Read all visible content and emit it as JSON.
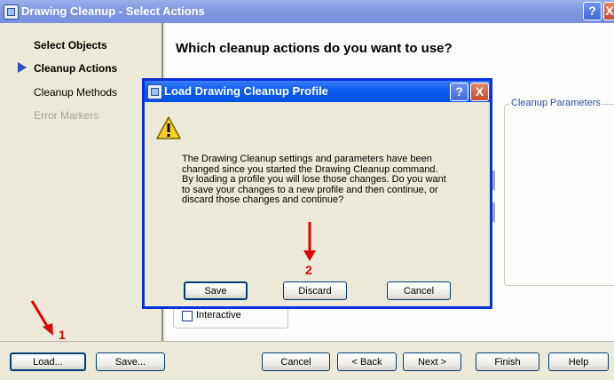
{
  "window": {
    "title": "Drawing Cleanup - Select Actions",
    "help_glyph": "?",
    "close_glyph": "X"
  },
  "nav": {
    "items": [
      {
        "label": "Select Objects",
        "state": "bold"
      },
      {
        "label": "Cleanup Actions",
        "state": "current"
      },
      {
        "label": "Cleanup Methods",
        "state": "normal"
      },
      {
        "label": "Error Markers",
        "state": "disabled"
      }
    ]
  },
  "main": {
    "heading": "Which cleanup actions do you want to use?",
    "params_group_label": "Cleanup Parameters",
    "interactive_label": "Interactive",
    "interactive_checked": false
  },
  "dialog": {
    "title": "Load Drawing Cleanup Profile",
    "message": "The Drawing Cleanup settings and parameters have been changed since you started the Drawing Cleanup command. By loading a profile you will lose those changes. Do you want to save your changes to a new profile and then continue, or discard those changes and continue?",
    "buttons": {
      "save": "Save",
      "discard": "Discard",
      "cancel": "Cancel"
    },
    "warning_glyph": "!"
  },
  "footer": {
    "load": "Load...",
    "save": "Save...",
    "cancel": "Cancel",
    "back": "< Back",
    "next": "Next >",
    "finish": "Finish",
    "help": "Help"
  },
  "annotations": {
    "marker_1": "1",
    "marker_2": "2",
    "arrow_color": "#e00000"
  },
  "colors": {
    "xp_title_blue": "#0a5bec",
    "nav_indicator": "#2c4fbe",
    "group_label": "#2f52a0"
  }
}
